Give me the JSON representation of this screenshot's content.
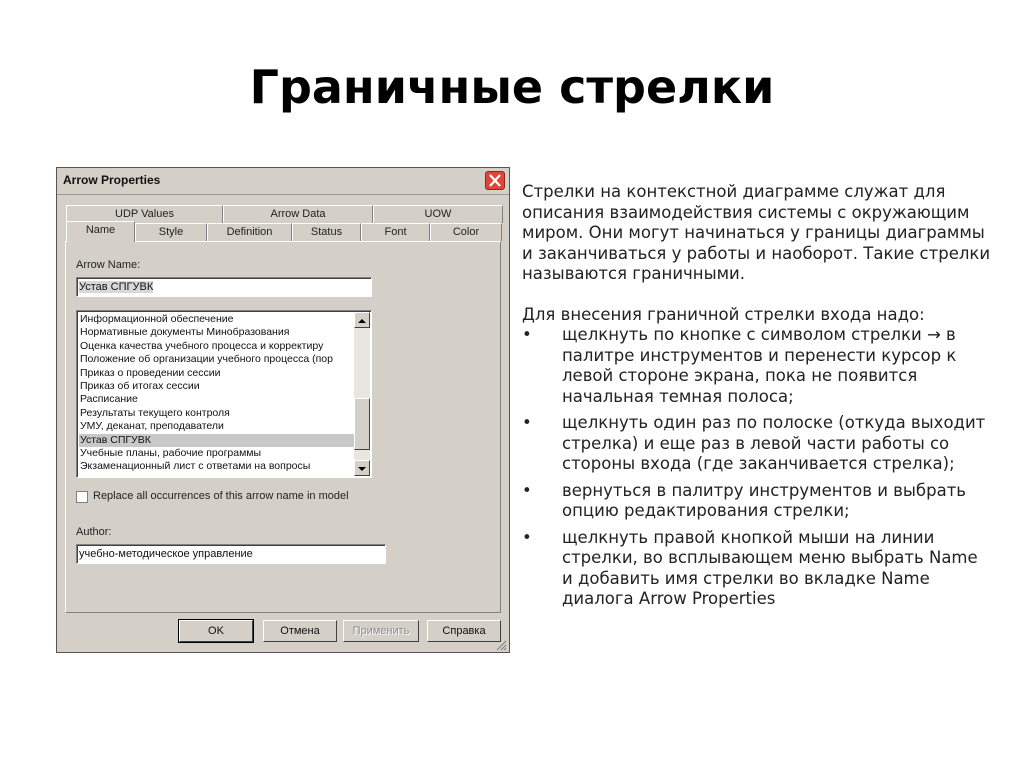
{
  "slide": {
    "title": "Граничные стрелки"
  },
  "dialog": {
    "title": "Arrow Properties",
    "tabs_row1": [
      "UDP Values",
      "Arrow Data",
      "UOW"
    ],
    "tabs_row2": [
      "Name",
      "Style",
      "Definition",
      "Status",
      "Font",
      "Color"
    ],
    "active_tab": "Name",
    "arrow_name_label": "Arrow Name:",
    "arrow_name_value": "Устав СПГУВК",
    "list_items": [
      "Информационной обеспечение",
      "Нормативные документы Минобразования",
      "Оценка качества учебного процесса и корректиру",
      "Положение об организации учебного процесса (пор",
      "Приказ о проведении сессии",
      "Приказ об итогах сессии",
      "Расписание",
      "Результаты текущего контроля",
      "УМУ, деканат, преподаватели",
      "Устав СПГУВК",
      "Учебные планы, рабочие программы",
      "Экзаменационный лист с ответами на вопросы"
    ],
    "selected_item": "Устав СПГУВК",
    "replace_checkbox_label": "Replace all occurrences of this arrow name in model",
    "replace_checked": false,
    "author_label": "Author:",
    "author_value": "учебно-методическое управление",
    "buttons": {
      "ok": "OK",
      "cancel": "Отмена",
      "apply": "Применить",
      "help": "Справка"
    }
  },
  "text": {
    "intro": "Стрелки на контекстной диаграмме служат для описания взаимодействия системы с окружающим миром. Они могут начинаться у границы диаграммы и заканчиваться у работы и наоборот. Такие стрелки называются граничными.",
    "steps_title": "Для внесения граничной стрелки входа надо:",
    "bullet_char": "•",
    "steps": [
      "щелкнуть по кнопке с символом стрелки → в палитре инструментов и перенести курсор к левой стороне экрана, пока не появится начальная темная полоса;",
      "щелкнуть один раз по полоске (откуда выходит стрелка) и еще раз в левой части работы со стороны входа (где заканчивается стрелка);",
      "вернуться в палитру инструментов и выбрать опцию редактирования стрелки;",
      "щелкнуть правой кнопкой мыши на линии стрелки, во всплывающем меню выбрать Name и добавить имя стрелки во вкладке Name диалога Arrow Properties"
    ]
  }
}
